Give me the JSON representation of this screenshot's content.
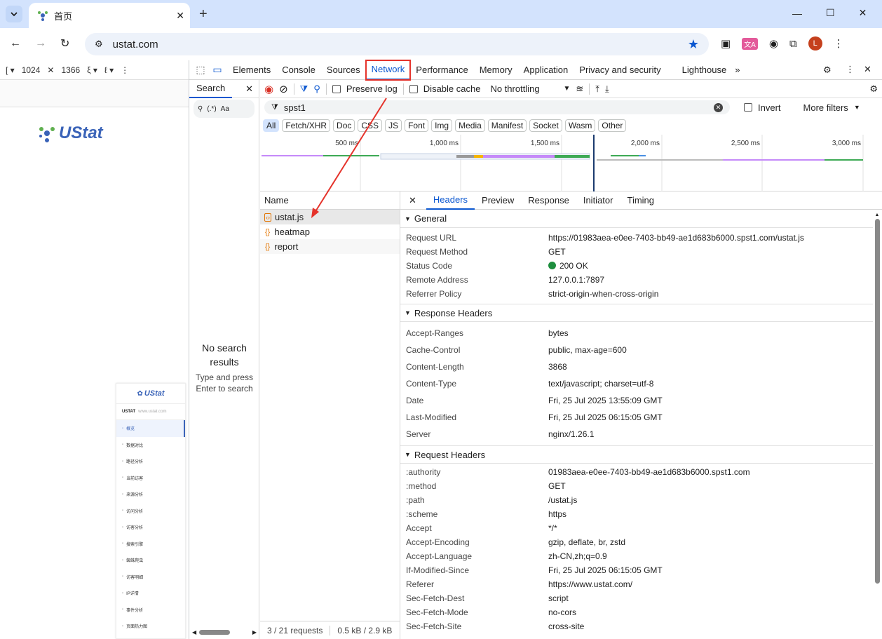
{
  "browser": {
    "tab_title": "首页",
    "new_tab": "+",
    "url": "ustat.com",
    "avatar_letter": "L",
    "window_controls": [
      "minimize",
      "maximize",
      "close"
    ]
  },
  "page": {
    "device_width": "1024",
    "device_height": "1366",
    "brand": "UStat",
    "mini_brand": "UStat",
    "mini_header": "USTAT",
    "mini_url": "www.ustat.com",
    "mini_menu": [
      "概览",
      "数据对比",
      "路径分析",
      "当前访客",
      "来源分析",
      "访问分析",
      "访客分析",
      "搜索引擎",
      "蜘蛛爬虫",
      "访客明细",
      "IP详情",
      "事件分析",
      "页面热力图"
    ]
  },
  "devtools": {
    "tabs": [
      "Elements",
      "Console",
      "Sources",
      "Network",
      "Performance",
      "Memory",
      "Application",
      "Privacy and security",
      "Lighthouse"
    ],
    "active_tab": "Network",
    "search": {
      "tab_label": "Search",
      "case_label": "Aa",
      "regex_label": "(.*)",
      "empty_title": "No search results",
      "empty_hint": "Type and press Enter to search"
    },
    "network": {
      "preserve_log": "Preserve log",
      "disable_cache": "Disable cache",
      "throttling": "No throttling",
      "filter_value": "spst1",
      "invert": "Invert",
      "more_filters": "More filters",
      "types": [
        "All",
        "Fetch/XHR",
        "Doc",
        "CSS",
        "JS",
        "Font",
        "Img",
        "Media",
        "Manifest",
        "Socket",
        "Wasm",
        "Other"
      ],
      "active_type": "All",
      "timeline_ticks": [
        "500 ms",
        "1,000 ms",
        "1,500 ms",
        "2,000 ms",
        "2,500 ms",
        "3,000 ms"
      ],
      "name_header": "Name",
      "requests": [
        {
          "name": "ustat.js",
          "selected": true,
          "kind": "js"
        },
        {
          "name": "heatmap",
          "selected": false,
          "kind": "fetch"
        },
        {
          "name": "report",
          "selected": false,
          "kind": "fetch"
        }
      ],
      "footer_requests": "3 / 21 requests",
      "footer_size": "0.5 kB / 2.9 kB"
    },
    "detail": {
      "tabs": [
        "Headers",
        "Preview",
        "Response",
        "Initiator",
        "Timing"
      ],
      "active_tab": "Headers",
      "general_title": "General",
      "general": [
        {
          "k": "Request URL",
          "v": "https://01983aea-e0ee-7403-bb49-ae1d683b6000.spst1.com/ustat.js"
        },
        {
          "k": "Request Method",
          "v": "GET"
        },
        {
          "k": "Status Code",
          "v": "200 OK"
        },
        {
          "k": "Remote Address",
          "v": "127.0.0.1:7897"
        },
        {
          "k": "Referrer Policy",
          "v": "strict-origin-when-cross-origin"
        }
      ],
      "response_title": "Response Headers",
      "response": [
        {
          "k": "Accept-Ranges",
          "v": "bytes"
        },
        {
          "k": "Cache-Control",
          "v": "public, max-age=600"
        },
        {
          "k": "Content-Length",
          "v": "3868"
        },
        {
          "k": "Content-Type",
          "v": "text/javascript; charset=utf-8"
        },
        {
          "k": "Date",
          "v": "Fri, 25 Jul 2025 13:55:09 GMT"
        },
        {
          "k": "Last-Modified",
          "v": "Fri, 25 Jul 2025 06:15:05 GMT"
        },
        {
          "k": "Server",
          "v": "nginx/1.26.1"
        }
      ],
      "request_title": "Request Headers",
      "request": [
        {
          "k": ":authority",
          "v": "01983aea-e0ee-7403-bb49-ae1d683b6000.spst1.com"
        },
        {
          "k": ":method",
          "v": "GET"
        },
        {
          "k": ":path",
          "v": "/ustat.js"
        },
        {
          "k": ":scheme",
          "v": "https"
        },
        {
          "k": "Accept",
          "v": "*/*"
        },
        {
          "k": "Accept-Encoding",
          "v": "gzip, deflate, br, zstd"
        },
        {
          "k": "Accept-Language",
          "v": "zh-CN,zh;q=0.9"
        },
        {
          "k": "If-Modified-Since",
          "v": "Fri, 25 Jul 2025 06:15:05 GMT"
        },
        {
          "k": "Referer",
          "v": "https://www.ustat.com/"
        },
        {
          "k": "Sec-Fetch-Dest",
          "v": "script"
        },
        {
          "k": "Sec-Fetch-Mode",
          "v": "no-cors"
        },
        {
          "k": "Sec-Fetch-Site",
          "v": "cross-site"
        }
      ]
    }
  },
  "colors": {
    "accent": "#0b57d0",
    "annotation": "#e5332b",
    "status_ok": "#1e8e3e",
    "brand_blue": "#3a63b8",
    "brand_green": "#5fb04f"
  }
}
